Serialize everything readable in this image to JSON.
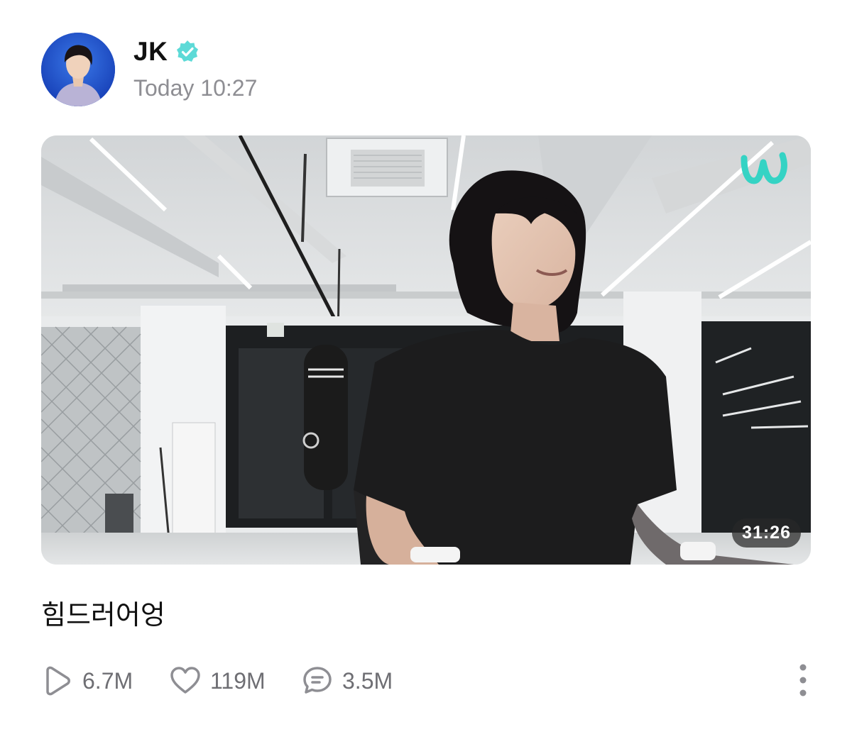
{
  "post": {
    "author": "JK",
    "timestamp": "Today 10:27",
    "caption": "힘드러어엉",
    "verified_color": "#5ddad7"
  },
  "video": {
    "duration": "31:26",
    "brand_color": "#35d3c4"
  },
  "stats": {
    "plays": "6.7M",
    "likes": "119M",
    "comments": "3.5M"
  },
  "icons": {
    "verified": "verified-badge-icon",
    "play": "play-icon",
    "like": "heart-icon",
    "comment": "comment-icon",
    "more": "more-vertical-icon",
    "brand": "weverse-logo-icon"
  }
}
